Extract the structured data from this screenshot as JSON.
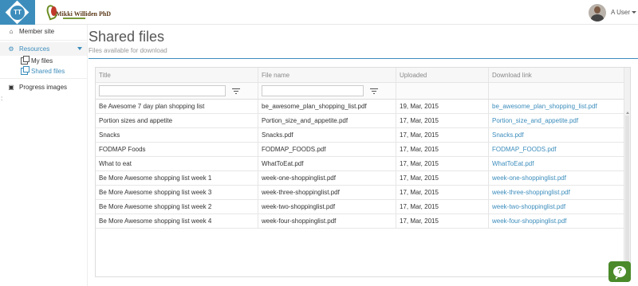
{
  "brand": {
    "logo_initials": "TT",
    "wordmark": "Mikki Williden PhD"
  },
  "user": {
    "name": "A User"
  },
  "sidebar": {
    "items": [
      {
        "label": "Member site",
        "icon": "home-icon"
      },
      {
        "label": "Resources",
        "icon": "cogs-icon"
      },
      {
        "label": "Progress images",
        "icon": "image-icon"
      }
    ],
    "sub_items": [
      {
        "label": "My files",
        "icon": "files-icon"
      },
      {
        "label": "Shared files",
        "icon": "files-icon"
      }
    ]
  },
  "page": {
    "title": "Shared files",
    "subtitle": "Files available for download"
  },
  "table": {
    "columns": [
      "Title",
      "File name",
      "Uploaded",
      "Download link"
    ],
    "rows": [
      [
        "Be Awesome 7 day plan shopping list",
        "be_awesome_plan_shopping_list.pdf",
        "19, Mar, 2015",
        "be_awesome_plan_shopping_list.pdf"
      ],
      [
        "Portion sizes and appetite",
        "Portion_size_and_appetite.pdf",
        "17, Mar, 2015",
        "Portion_size_and_appetite.pdf"
      ],
      [
        "Snacks",
        "Snacks.pdf",
        "17, Mar, 2015",
        "Snacks.pdf"
      ],
      [
        "FODMAP Foods",
        "FODMAP_FOODS.pdf",
        "17, Mar, 2015",
        "FODMAP_FOODS.pdf"
      ],
      [
        "What to eat",
        "WhatToEat.pdf",
        "17, Mar, 2015",
        "WhatToEat.pdf"
      ],
      [
        "Be More Awesome shopping list week 1",
        "week-one-shoppinglist.pdf",
        "17, Mar, 2015",
        "week-one-shoppinglist.pdf"
      ],
      [
        "Be More Awesome shopping list week 3",
        "week-three-shoppinglist.pdf",
        "17, Mar, 2015",
        "week-three-shoppinglist.pdf"
      ],
      [
        "Be More Awesome shopping list week 2",
        "week-two-shoppinglist.pdf",
        "17, Mar, 2015",
        "week-two-shoppinglist.pdf"
      ],
      [
        "Be More Awesome shopping list week 4",
        "week-four-shoppinglist.pdf",
        "17, Mar, 2015",
        "week-four-shoppinglist.pdf"
      ]
    ]
  },
  "help": {
    "glyph": "?"
  },
  "colors": {
    "accent": "#3c8dbc",
    "help_green": "#4a8a2a"
  }
}
